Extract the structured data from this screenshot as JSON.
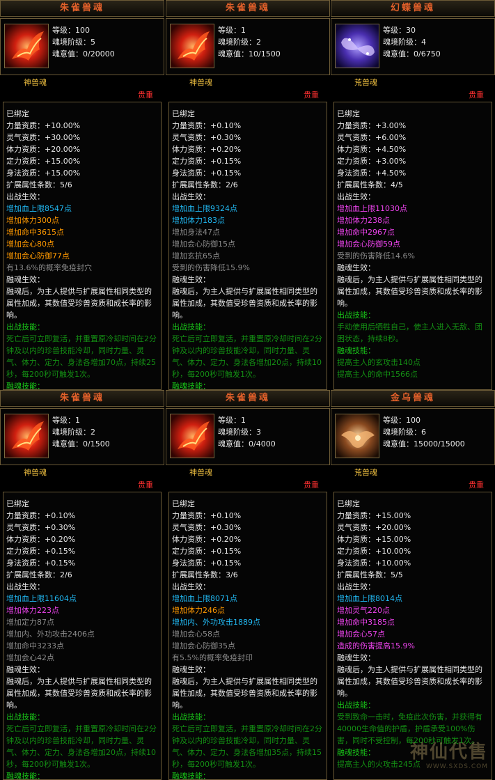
{
  "cards": [
    {
      "name": "朱雀兽魂",
      "level": "等级：100",
      "tier": "魂境阶级：5",
      "will": "魂意值：0/20000",
      "type": "神兽魂",
      "rarity": "贵重",
      "icon": "vermilion-bird-icon",
      "lines": [
        {
          "t": "已绑定",
          "c": "w"
        },
        {
          "t": "力量资质：+10.00%",
          "c": "w"
        },
        {
          "t": "灵气资质：+30.00%",
          "c": "w"
        },
        {
          "t": "体力资质：+20.00%",
          "c": "w"
        },
        {
          "t": "定力资质：+15.00%",
          "c": "w"
        },
        {
          "t": "身法资质：+15.00%",
          "c": "w"
        },
        {
          "t": "扩展属性条数：5/6",
          "c": "w"
        },
        {
          "t": "出战生效：",
          "c": "w"
        },
        {
          "t": "增加血上限8547点",
          "c": "cyan"
        },
        {
          "t": "增加体力300点",
          "c": "orange"
        },
        {
          "t": "增加命中3615点",
          "c": "orange"
        },
        {
          "t": "增加会心80点",
          "c": "orange"
        },
        {
          "t": "增加会心防御77点",
          "c": "orange"
        },
        {
          "t": "有13.6%的概率免疫封穴",
          "c": "gray"
        },
        {
          "t": "融魂生效：",
          "c": "w"
        },
        {
          "t": "融魂后，为主人提供与扩展属性相同类型的属性加成，其数值受珍兽资质和成长率的影响。",
          "c": "w",
          "wrap": true
        },
        {
          "t": "出战技能：",
          "c": "g"
        },
        {
          "t": "死亡后可立即复活，并重置原冷却时间在2分钟及以内的珍兽技能冷却，同时力量、灵气、体力、定力、身法各增加70点，持续25秒，每200秒可触发1次。",
          "c": "dg",
          "wrap": true
        },
        {
          "t": "融魂技能：",
          "c": "g"
        }
      ]
    },
    {
      "name": "朱雀兽魂",
      "level": "等级：1",
      "tier": "魂境阶级：2",
      "will": "魂意值：10/1500",
      "type": "神兽魂",
      "rarity": "贵重",
      "icon": "vermilion-bird-icon",
      "lines": [
        {
          "t": "已绑定",
          "c": "w"
        },
        {
          "t": "力量资质：+0.10%",
          "c": "w"
        },
        {
          "t": "灵气资质：+0.30%",
          "c": "w"
        },
        {
          "t": "体力资质：+0.20%",
          "c": "w"
        },
        {
          "t": "定力资质：+0.15%",
          "c": "w"
        },
        {
          "t": "身法资质：+0.15%",
          "c": "w"
        },
        {
          "t": "扩展属性条数：2/6",
          "c": "w"
        },
        {
          "t": "出战生效：",
          "c": "w"
        },
        {
          "t": "增加血上限9324点",
          "c": "cyan"
        },
        {
          "t": "增加体力183点",
          "c": "cyan"
        },
        {
          "t": "增加身法47点",
          "c": "gray"
        },
        {
          "t": "增加会心防御15点",
          "c": "gray"
        },
        {
          "t": "增加玄抗65点",
          "c": "gray"
        },
        {
          "t": "受到的伤害降低15.9%",
          "c": "gray"
        },
        {
          "t": "融魂生效：",
          "c": "w"
        },
        {
          "t": "融魂后，为主人提供与扩展属性相同类型的属性加成，其数值受珍兽资质和成长率的影响。",
          "c": "w",
          "wrap": true
        },
        {
          "t": "出战技能：",
          "c": "g"
        },
        {
          "t": "死亡后可立即复活，并重置原冷却时间在2分钟及以内的珍兽技能冷却，同时力量、灵气、体力、定力、身法各增加20点，持续10秒，每200秒可触发1次。",
          "c": "dg",
          "wrap": true
        },
        {
          "t": "融魂技能：",
          "c": "g"
        }
      ]
    },
    {
      "name": "幻蝶兽魂",
      "level": "等级：30",
      "tier": "魂境阶级：4",
      "will": "魂意值：0/6750",
      "type": "荒兽魂",
      "rarity": "贵重",
      "icon": "illusion-butterfly-icon",
      "lines": [
        {
          "t": "已绑定",
          "c": "w"
        },
        {
          "t": "力量资质：+3.00%",
          "c": "w"
        },
        {
          "t": "灵气资质：+6.00%",
          "c": "w"
        },
        {
          "t": "体力资质：+4.50%",
          "c": "w"
        },
        {
          "t": "定力资质：+3.00%",
          "c": "w"
        },
        {
          "t": "身法资质：+4.50%",
          "c": "w"
        },
        {
          "t": "扩展属性条数：4/5",
          "c": "w"
        },
        {
          "t": "出战生效：",
          "c": "w"
        },
        {
          "t": "增加血上限11030点",
          "c": "mag"
        },
        {
          "t": "增加体力238点",
          "c": "mag"
        },
        {
          "t": "增加命中2967点",
          "c": "mag"
        },
        {
          "t": "增加会心防御59点",
          "c": "mag"
        },
        {
          "t": "受到的伤害降低14.6%",
          "c": "gray"
        },
        {
          "t": "融魂生效：",
          "c": "w"
        },
        {
          "t": "融魂后，为主人提供与扩展属性相同类型的属性加成，其数值受珍兽资质和成长率的影响。",
          "c": "w",
          "wrap": true
        },
        {
          "t": "出战技能：",
          "c": "g"
        },
        {
          "t": "手动使用后牺牲自己，使主人进入无敌、团困状态，持续8秒。",
          "c": "dg",
          "wrap": true
        },
        {
          "t": "融魂技能：",
          "c": "g"
        },
        {
          "t": "提高主人的玄攻击140点",
          "c": "dg"
        },
        {
          "t": "提高主人的命中1566点",
          "c": "dg"
        }
      ]
    },
    {
      "name": "朱雀兽魂",
      "level": "等级：1",
      "tier": "魂境阶级：2",
      "will": "魂意值：0/1500",
      "type": "神兽魂",
      "rarity": "贵重",
      "icon": "vermilion-bird-icon",
      "lines": [
        {
          "t": "已绑定",
          "c": "w"
        },
        {
          "t": "力量资质：+0.10%",
          "c": "w"
        },
        {
          "t": "灵气资质：+0.30%",
          "c": "w"
        },
        {
          "t": "体力资质：+0.20%",
          "c": "w"
        },
        {
          "t": "定力资质：+0.15%",
          "c": "w"
        },
        {
          "t": "身法资质：+0.15%",
          "c": "w"
        },
        {
          "t": "扩展属性条数：2/6",
          "c": "w"
        },
        {
          "t": "出战生效：",
          "c": "w"
        },
        {
          "t": "增加血上限11604点",
          "c": "cyan"
        },
        {
          "t": "增加体力223点",
          "c": "mag"
        },
        {
          "t": "增加定力87点",
          "c": "gray"
        },
        {
          "t": "增加内、外功攻击2406点",
          "c": "gray"
        },
        {
          "t": "增加命中3233点",
          "c": "gray"
        },
        {
          "t": "增加会心42点",
          "c": "gray"
        },
        {
          "t": "融魂生效：",
          "c": "w"
        },
        {
          "t": "融魂后，为主人提供与扩展属性相同类型的属性加成，其数值受珍兽资质和成长率的影响。",
          "c": "w",
          "wrap": true
        },
        {
          "t": "出战技能：",
          "c": "g"
        },
        {
          "t": "死亡后可立即复活，并重置原冷却时间在2分钟及以内的珍兽技能冷却，同时力量、灵气、体力、定力、身法各增加20点，持续10秒，每200秒可触发1次。",
          "c": "dg",
          "wrap": true
        },
        {
          "t": "融魂技能：",
          "c": "g"
        }
      ]
    },
    {
      "name": "朱雀兽魂",
      "level": "等级：1",
      "tier": "魂境阶级：3",
      "will": "魂意值：0/4000",
      "type": "神兽魂",
      "rarity": "贵重",
      "icon": "vermilion-bird-icon",
      "lines": [
        {
          "t": "已绑定",
          "c": "w"
        },
        {
          "t": "力量资质：+0.10%",
          "c": "w"
        },
        {
          "t": "灵气资质：+0.30%",
          "c": "w"
        },
        {
          "t": "体力资质：+0.20%",
          "c": "w"
        },
        {
          "t": "定力资质：+0.15%",
          "c": "w"
        },
        {
          "t": "身法资质：+0.15%",
          "c": "w"
        },
        {
          "t": "扩展属性条数：3/6",
          "c": "w"
        },
        {
          "t": "出战生效：",
          "c": "w"
        },
        {
          "t": "增加血上限8071点",
          "c": "cyan"
        },
        {
          "t": "增加体力246点",
          "c": "orange"
        },
        {
          "t": "增加内、外功攻击1889点",
          "c": "cyan"
        },
        {
          "t": "增加会心58点",
          "c": "gray"
        },
        {
          "t": "增加会心防御35点",
          "c": "gray"
        },
        {
          "t": "有5.5%的概率免疫封印",
          "c": "gray"
        },
        {
          "t": "融魂生效：",
          "c": "w"
        },
        {
          "t": "融魂后，为主人提供与扩展属性相同类型的属性加成，其数值受珍兽资质和成长率的影响。",
          "c": "w",
          "wrap": true
        },
        {
          "t": "出战技能：",
          "c": "g"
        },
        {
          "t": "死亡后可立即复活，并重置原冷却时间在2分钟及以内的珍兽技能冷却，同时力量、灵气、体力、定力、身法各增加35点，持续15秒，每200秒可触发1次。",
          "c": "dg",
          "wrap": true
        },
        {
          "t": "融魂技能：",
          "c": "g"
        }
      ]
    },
    {
      "name": "金乌兽魂",
      "level": "等级：100",
      "tier": "魂境阶级：6",
      "will": "魂意值：15000/15000",
      "type": "荒兽魂",
      "rarity": "贵重",
      "icon": "golden-crow-icon",
      "lines": [
        {
          "t": "已绑定",
          "c": "w"
        },
        {
          "t": "力量资质：+15.00%",
          "c": "w"
        },
        {
          "t": "灵气资质：+20.00%",
          "c": "w"
        },
        {
          "t": "体力资质：+15.00%",
          "c": "w"
        },
        {
          "t": "定力资质：+10.00%",
          "c": "w"
        },
        {
          "t": "身法资质：+10.00%",
          "c": "w"
        },
        {
          "t": "扩展属性条数：5/5",
          "c": "w"
        },
        {
          "t": "出战生效：",
          "c": "w"
        },
        {
          "t": "增加血上限8014点",
          "c": "cyan"
        },
        {
          "t": "增加灵气220点",
          "c": "mag"
        },
        {
          "t": "增加命中3185点",
          "c": "mag"
        },
        {
          "t": "增加会心57点",
          "c": "mag"
        },
        {
          "t": "造成的伤害提高15.9%",
          "c": "mag"
        },
        {
          "t": "融魂生效：",
          "c": "w"
        },
        {
          "t": "融魂后，为主人提供与扩展属性相同类型的属性加成，其数值受珍兽资质和成长率的影响。",
          "c": "w",
          "wrap": true
        },
        {
          "t": "出战技能：",
          "c": "g"
        },
        {
          "t": "受到致命一击时，免疫此次伤害，并获得有40000生命值的护盾，护盾承受100%伤害，同时不受控制，每200秒可触发1次。",
          "c": "dg",
          "wrap": true
        },
        {
          "t": "融魂技能：",
          "c": "g"
        },
        {
          "t": "提高主人的火攻击245点",
          "c": "dg"
        }
      ]
    }
  ],
  "watermark": {
    "title": "神仙代售",
    "url": "WWW.SXDS.COM"
  }
}
